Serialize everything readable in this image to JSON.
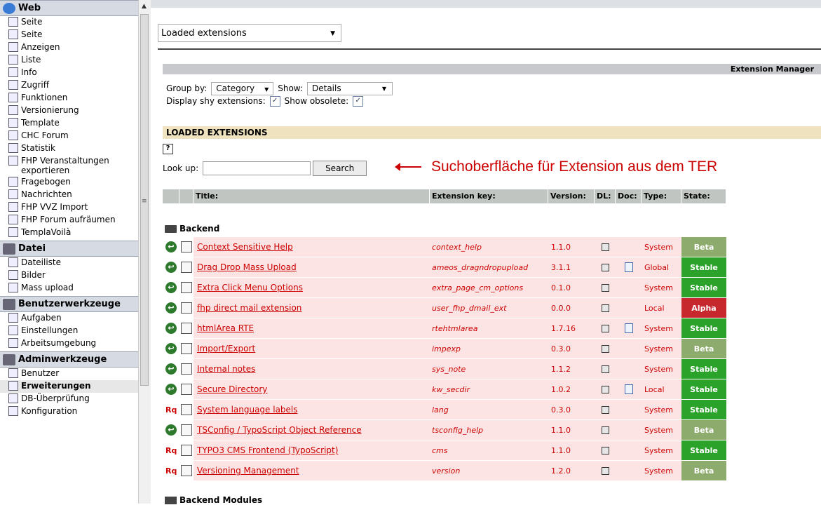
{
  "sidebar": {
    "sections": [
      {
        "title": "Web",
        "icon": "globe-icon",
        "items": [
          {
            "label": "Seite",
            "icon": "page-edit-icon"
          },
          {
            "label": "Seite",
            "icon": "page-icon"
          },
          {
            "label": "Anzeigen",
            "icon": "magnifier-icon"
          },
          {
            "label": "Liste",
            "icon": "list-icon"
          },
          {
            "label": "Info",
            "icon": "info-icon"
          },
          {
            "label": "Zugriff",
            "icon": "access-icon"
          },
          {
            "label": "Funktionen",
            "icon": "functions-icon"
          },
          {
            "label": "Versionierung",
            "icon": "versioning-icon"
          },
          {
            "label": "Template",
            "icon": "template-icon"
          },
          {
            "label": "CHC Forum",
            "icon": "forum-icon"
          },
          {
            "label": "Statistik",
            "icon": "statistics-icon"
          },
          {
            "label": "FHP Veranstaltungen exportieren",
            "icon": "export-icon"
          },
          {
            "label": "Fragebogen",
            "icon": "questionnaire-icon"
          },
          {
            "label": "Nachrichten",
            "icon": "news-icon"
          },
          {
            "label": "FHP VVZ Import",
            "icon": "import-icon"
          },
          {
            "label": "FHP Forum aufräumen",
            "icon": "cleanup-icon"
          },
          {
            "label": "TemplaVoilà",
            "icon": "templavoila-icon"
          }
        ]
      },
      {
        "title": "Datei",
        "icon": "drive-icon",
        "items": [
          {
            "label": "Dateiliste",
            "icon": "filelist-icon"
          },
          {
            "label": "Bilder",
            "icon": "camera-icon"
          },
          {
            "label": "Mass upload",
            "icon": "upload-icon"
          }
        ]
      },
      {
        "title": "Benutzerwerkzeuge",
        "icon": "user-tools-icon",
        "items": [
          {
            "label": "Aufgaben",
            "icon": "tasks-icon"
          },
          {
            "label": "Einstellungen",
            "icon": "settings-icon"
          },
          {
            "label": "Arbeitsumgebung",
            "icon": "workspace-icon"
          }
        ]
      },
      {
        "title": "Adminwerkzeuge",
        "icon": "admin-tools-icon",
        "items": [
          {
            "label": "Benutzer",
            "icon": "users-icon"
          },
          {
            "label": "Erweiterungen",
            "icon": "extensions-icon",
            "active": true
          },
          {
            "label": "DB-Überprüfung",
            "icon": "database-icon"
          },
          {
            "label": "Konfiguration",
            "icon": "configuration-icon"
          }
        ]
      }
    ]
  },
  "menu": {
    "selected": "Loaded extensions"
  },
  "header": {
    "title": "Extension Manager"
  },
  "options": {
    "group_by_label": "Group by:",
    "group_by_value": "Category",
    "show_label": "Show:",
    "show_value": "Details",
    "shy_label": "Display shy extensions:",
    "obsolete_label": "Show obsolete:",
    "shy_checked": true,
    "obsolete_checked": true
  },
  "loaded_title": "LOADED EXTENSIONS",
  "lookup": {
    "label": "Look up:",
    "value": "",
    "button": "Search"
  },
  "annotation": "Suchoberfläche für Extension aus dem TER",
  "table": {
    "headers": {
      "title": "Title:",
      "key": "Extension key:",
      "version": "Version:",
      "dl": "DL:",
      "doc": "Doc:",
      "type": "Type:",
      "state": "State:"
    },
    "category": "Backend",
    "rows": [
      {
        "status": "installed",
        "title": "Context Sensitive Help",
        "key": "context_help",
        "version": "1.1.0",
        "doc": false,
        "type": "System",
        "state": "Beta"
      },
      {
        "status": "installed",
        "title": "Drag Drop Mass Upload",
        "key": "ameos_dragndropupload",
        "version": "3.1.1",
        "doc": true,
        "type": "Global",
        "state": "Stable"
      },
      {
        "status": "installed",
        "title": "Extra Click Menu Options",
        "key": "extra_page_cm_options",
        "version": "0.1.0",
        "doc": false,
        "type": "System",
        "state": "Stable"
      },
      {
        "status": "installed",
        "title": "fhp direct mail extension",
        "key": "user_fhp_dmail_ext",
        "version": "0.0.0",
        "doc": false,
        "type": "Local",
        "state": "Alpha"
      },
      {
        "status": "installed",
        "title": "htmlArea RTE",
        "key": "rtehtmlarea",
        "version": "1.7.16",
        "doc": true,
        "type": "System",
        "state": "Stable"
      },
      {
        "status": "installed",
        "title": "Import/Export",
        "key": "impexp",
        "version": "0.3.0",
        "doc": false,
        "type": "System",
        "state": "Beta"
      },
      {
        "status": "installed",
        "title": "Internal notes",
        "key": "sys_note",
        "version": "1.1.2",
        "doc": false,
        "type": "System",
        "state": "Stable"
      },
      {
        "status": "installed",
        "title": "Secure Directory",
        "key": "kw_secdir",
        "version": "1.0.2",
        "doc": true,
        "type": "Local",
        "state": "Stable"
      },
      {
        "status": "required",
        "title": "System language labels",
        "key": "lang",
        "version": "0.3.0",
        "doc": false,
        "type": "System",
        "state": "Stable"
      },
      {
        "status": "installed",
        "title": "TSConfig / TypoScript Object Reference",
        "key": "tsconfig_help",
        "version": "1.1.0",
        "doc": false,
        "type": "System",
        "state": "Beta"
      },
      {
        "status": "required",
        "title": "TYPO3 CMS Frontend (TypoScript)",
        "key": "cms",
        "version": "1.1.0",
        "doc": false,
        "type": "System",
        "state": "Stable"
      },
      {
        "status": "required",
        "title": "Versioning Management",
        "key": "version",
        "version": "1.2.0",
        "doc": false,
        "type": "System",
        "state": "Beta"
      }
    ],
    "install_glyph": "↩",
    "required_label": "Rq",
    "next_category": "Backend Modules"
  },
  "colors": {
    "stable": "#2ba32b",
    "beta": "#8cab6c",
    "alpha": "#c7282e",
    "row_bg": "#fce4e4",
    "link": "#cc0000"
  }
}
